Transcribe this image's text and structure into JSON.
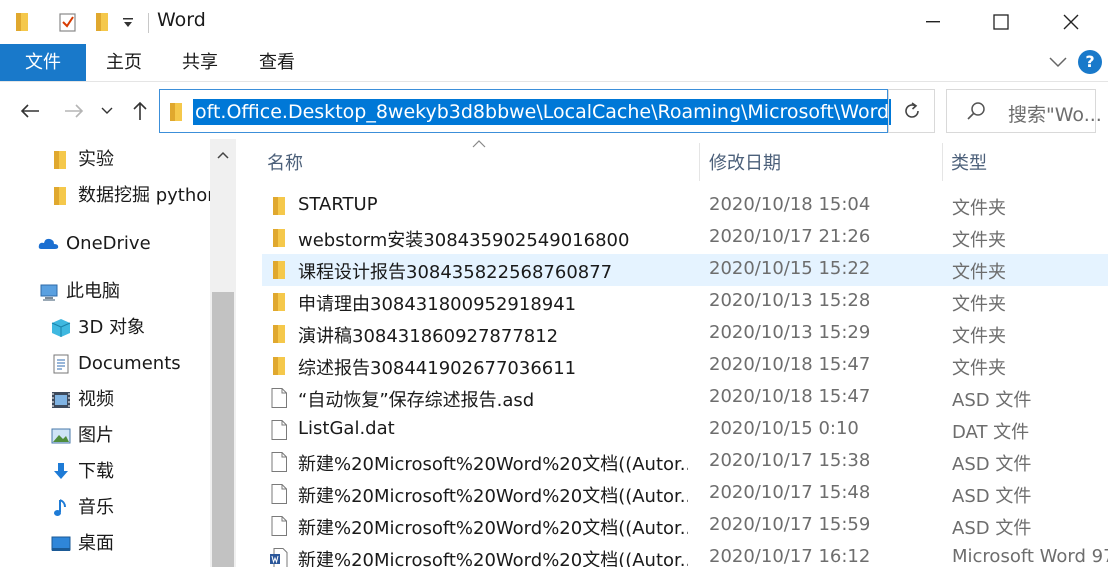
{
  "window": {
    "title": "Word",
    "minimize_glyph": "—",
    "maximize_glyph": "☐",
    "close_glyph": "✕"
  },
  "ribbon": {
    "tabs": [
      "文件",
      "主页",
      "共享",
      "查看"
    ],
    "help_label": "?"
  },
  "address": {
    "path": "oft.Office.Desktop_8wekyb3d8bbwe\\LocalCache\\Roaming\\Microsoft\\Word"
  },
  "search": {
    "placeholder": "搜索\"Wo..."
  },
  "sidebar": {
    "items": [
      {
        "label": "实验",
        "icon": "folder-icon"
      },
      {
        "label": "数据挖掘 python",
        "icon": "folder-icon"
      },
      {
        "label": "OneDrive",
        "icon": "cloud-icon"
      },
      {
        "label": "此电脑",
        "icon": "computer-icon"
      },
      {
        "label": "3D 对象",
        "icon": "cube-icon"
      },
      {
        "label": "Documents",
        "icon": "document-icon"
      },
      {
        "label": "视频",
        "icon": "video-icon"
      },
      {
        "label": "图片",
        "icon": "picture-icon"
      },
      {
        "label": "下载",
        "icon": "download-icon"
      },
      {
        "label": "音乐",
        "icon": "music-icon"
      },
      {
        "label": "桌面",
        "icon": "desktop-icon"
      }
    ]
  },
  "columns": {
    "name": "名称",
    "date": "修改日期",
    "type": "类型"
  },
  "files": [
    {
      "name": "STARTUP",
      "date": "2020/10/18 15:04",
      "type": "文件夹",
      "icon": "folder-icon"
    },
    {
      "name": "webstorm安装308435902549016800",
      "date": "2020/10/17 21:26",
      "type": "文件夹",
      "icon": "folder-icon"
    },
    {
      "name": "课程设计报告308435822568760877",
      "date": "2020/10/15 15:22",
      "type": "文件夹",
      "icon": "folder-icon"
    },
    {
      "name": "申请理由308431800952918941",
      "date": "2020/10/13 15:28",
      "type": "文件夹",
      "icon": "folder-icon"
    },
    {
      "name": "演讲稿308431860927877812",
      "date": "2020/10/13 15:29",
      "type": "文件夹",
      "icon": "folder-icon"
    },
    {
      "name": "综述报告308441902677036611",
      "date": "2020/10/18 15:47",
      "type": "文件夹",
      "icon": "folder-icon"
    },
    {
      "name": "“自动恢复”保存综述报告.asd",
      "date": "2020/10/18 15:47",
      "type": "ASD 文件",
      "icon": "file-icon"
    },
    {
      "name": "ListGal.dat",
      "date": "2020/10/15 0:10",
      "type": "DAT 文件",
      "icon": "file-icon"
    },
    {
      "name": "新建%20Microsoft%20Word%20文档((Autor...",
      "date": "2020/10/17 15:38",
      "type": "ASD 文件",
      "icon": "file-icon"
    },
    {
      "name": "新建%20Microsoft%20Word%20文档((Autor...",
      "date": "2020/10/17 15:48",
      "type": "ASD 文件",
      "icon": "file-icon"
    },
    {
      "name": "新建%20Microsoft%20Word%20文档((Autor...",
      "date": "2020/10/17 15:59",
      "type": "ASD 文件",
      "icon": "file-icon"
    },
    {
      "name": "新建%20Microsoft%20Word%20文档((Autor...",
      "date": "2020/10/17 16:12",
      "type": "Microsoft Word 97",
      "icon": "word-doc-icon"
    }
  ],
  "selected_row": 2,
  "colors": {
    "accent": "#1979ca",
    "selection": "#e5f3ff",
    "address_highlight": "#0078d7",
    "folder": "#f5c84b"
  }
}
